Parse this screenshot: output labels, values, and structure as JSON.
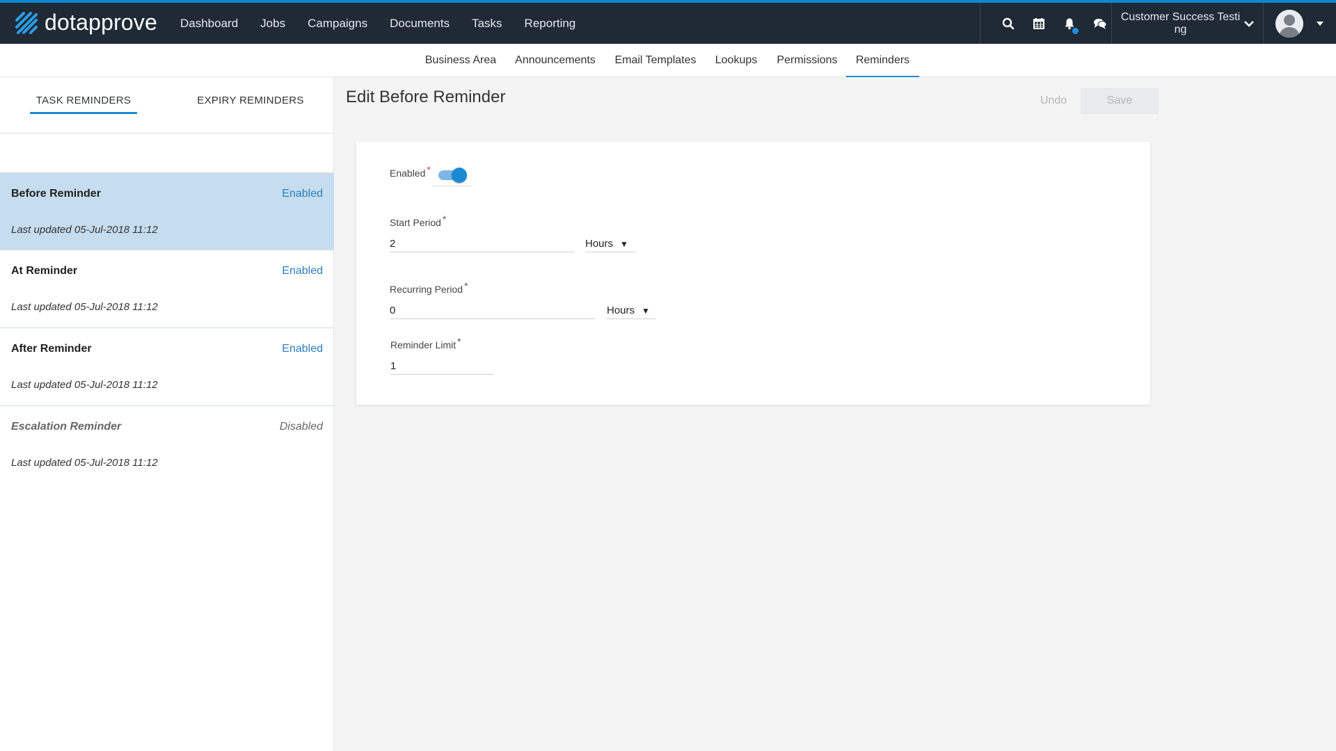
{
  "app": {
    "logo_text": "dotapprove"
  },
  "nav": {
    "items": [
      "Dashboard",
      "Jobs",
      "Campaigns",
      "Documents",
      "Tasks",
      "Reporting"
    ]
  },
  "user": {
    "name": "Customer Success Testing"
  },
  "subnav": {
    "items": [
      "Business Area",
      "Announcements",
      "Email Templates",
      "Lookups",
      "Permissions",
      "Reminders"
    ],
    "active": "Reminders"
  },
  "tabs": {
    "task": "TASK REMINDERS",
    "expiry": "EXPIRY REMINDERS"
  },
  "reminders": [
    {
      "name": "Before Reminder",
      "status": "Enabled",
      "updated": "Last updated 05-Jul-2018 11:12"
    },
    {
      "name": "At Reminder",
      "status": "Enabled",
      "updated": "Last updated 05-Jul-2018 11:12"
    },
    {
      "name": "After Reminder",
      "status": "Enabled",
      "updated": "Last updated 05-Jul-2018 11:12"
    },
    {
      "name": "Escalation Reminder",
      "status": "Disabled",
      "updated": "Last updated 05-Jul-2018 11:12"
    }
  ],
  "editor": {
    "title": "Edit Before Reminder",
    "undo_label": "Undo",
    "save_label": "Save",
    "enabled_label": "Enabled",
    "enabled_value": true,
    "required_mark": "*",
    "start_period_label": "Start Period",
    "start_period_value": "2",
    "start_period_unit": "Hours",
    "recurring_period_label": "Recurring Period",
    "recurring_period_value": "0",
    "recurring_period_unit": "Hours",
    "reminder_limit_label": "Reminder Limit",
    "reminder_limit_value": "1"
  },
  "colors": {
    "accent": "#1a8ad4",
    "topbar": "#1f2a36",
    "selected_row": "#c6ddef"
  }
}
